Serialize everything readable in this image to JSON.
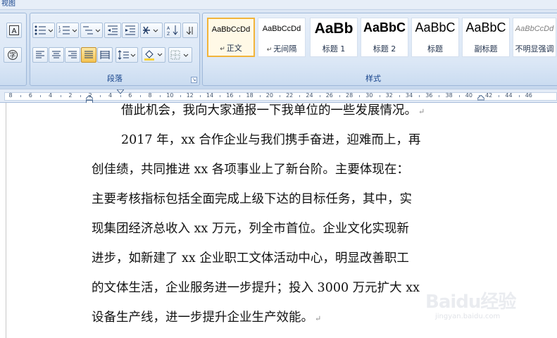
{
  "menu": {
    "view_label": "视图"
  },
  "paragraph_group": {
    "label": "段落"
  },
  "styles_group": {
    "label": "样式",
    "items": [
      {
        "sample": "AaBbCcDd",
        "name": "正文",
        "mark": "↵",
        "selected": true
      },
      {
        "sample": "AaBbCcDd",
        "name": "无间隔",
        "mark": "↵",
        "selected": false
      },
      {
        "sample": "AaBb",
        "name": "标题 1",
        "mark": "",
        "selected": false
      },
      {
        "sample": "AaBbC",
        "name": "标题 2",
        "mark": "",
        "selected": false
      },
      {
        "sample": "AaBbC",
        "name": "标题",
        "mark": "",
        "selected": false
      },
      {
        "sample": "AaBbC",
        "name": "副标题",
        "mark": "",
        "selected": false
      },
      {
        "sample": "AaBbCcDd",
        "name": "不明显强调",
        "mark": "",
        "selected": false
      }
    ]
  },
  "ruler": {
    "numbers": [
      "8",
      "6",
      "4",
      "2",
      "2",
      "4",
      "6",
      "8",
      "10",
      "12",
      "14",
      "16",
      "18",
      "20",
      "22",
      "24",
      "26",
      "28",
      "30",
      "32",
      "34",
      "36",
      "38",
      "40",
      "42",
      "44",
      "46"
    ]
  },
  "document": {
    "lines": [
      "借此机会，我向大家通报一下我单位的一些发展情况。",
      "2017 年，xx 合作企业与我们携手奋进，迎难而上，再",
      "创佳绩，共同推进 xx 各项事业上了新台阶。主要体现在：",
      "主要考核指标包括全面完成上级下达的目标任务，其中，实",
      "现集团经济总收入 xx 万元，列全市首位。企业文化实现新",
      "进步，如新建了 xx 企业职工文体活动中心，明显改善职工",
      "的文体生活，企业服务进一步提升；投入 3000 万元扩大 xx",
      "设备生产线，进一步提升企业生产效能。"
    ],
    "paragraph_mark": "↵"
  },
  "watermark": {
    "logo": "Baidu经验",
    "url": "jingyan.baidu.com"
  }
}
